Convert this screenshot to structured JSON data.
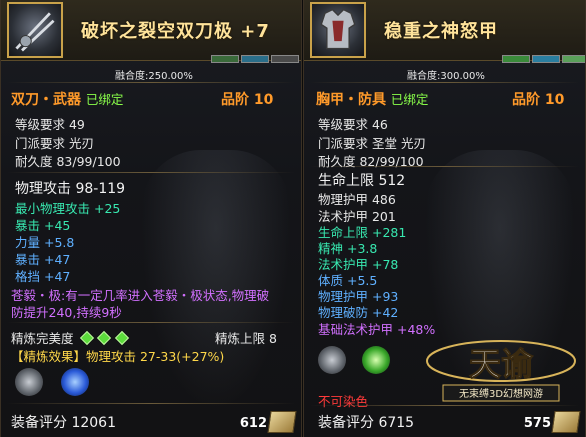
{
  "left": {
    "title": "破坏之裂空双刀极 +7",
    "fusion": "融合度:250.00%",
    "category": "双刀・武器",
    "bound": "已绑定",
    "grade": "品阶 10",
    "level_req": "等级要求  49",
    "school_req": "门派要求  光刃",
    "durability": "耐久度  83/99/100",
    "main_stat": "物理攻击  98-119",
    "bonus": [
      {
        "text": "最小物理攻击 +25",
        "color": "teal"
      },
      {
        "text": "暴击 +45",
        "color": "teal"
      },
      {
        "text": "力量 +5.8",
        "color": "blue"
      },
      {
        "text": "暴击 +47",
        "color": "blue"
      },
      {
        "text": "格挡 +47",
        "color": "blue"
      }
    ],
    "effect_line1": "苍毅・极:有一定几率进入苍毅・极状态,物理破",
    "effect_line2": "防提升240,持续9秒",
    "refine_label": "精炼完美度",
    "refine_cap": "精炼上限 8",
    "refine_effect": "【精炼效果】物理攻击  27-33(+27%)",
    "score": "装备评分  12061",
    "price": "612"
  },
  "right": {
    "title": "稳重之神怒甲",
    "fusion": "融合度:300.00%",
    "category": "胸甲・防具",
    "bound": "已绑定",
    "grade": "品阶 10",
    "level_req": "等级要求  46",
    "school_req": "门派要求  圣堂  光刃",
    "durability": "耐久度  82/99/100",
    "main_stat": "生命上限  512",
    "stats": [
      {
        "text": "物理护甲  486",
        "color": "white"
      },
      {
        "text": "法术护甲  201",
        "color": "white"
      },
      {
        "text": "生命上限 +281",
        "color": "teal"
      },
      {
        "text": "精神 +3.8",
        "color": "teal"
      },
      {
        "text": "法术护甲 +78",
        "color": "teal"
      },
      {
        "text": "体质 +5.5",
        "color": "blue"
      },
      {
        "text": "物理护甲 +93",
        "color": "blue"
      },
      {
        "text": "物理破防 +42",
        "color": "blue"
      },
      {
        "text": "基础法术护甲 +48%",
        "color": "purple"
      }
    ],
    "no_dye": "不可染色",
    "score": "装备评分  6715",
    "price": "575",
    "logo_main": "天谕",
    "logo_sub": "无束缚3D幻想网游"
  }
}
